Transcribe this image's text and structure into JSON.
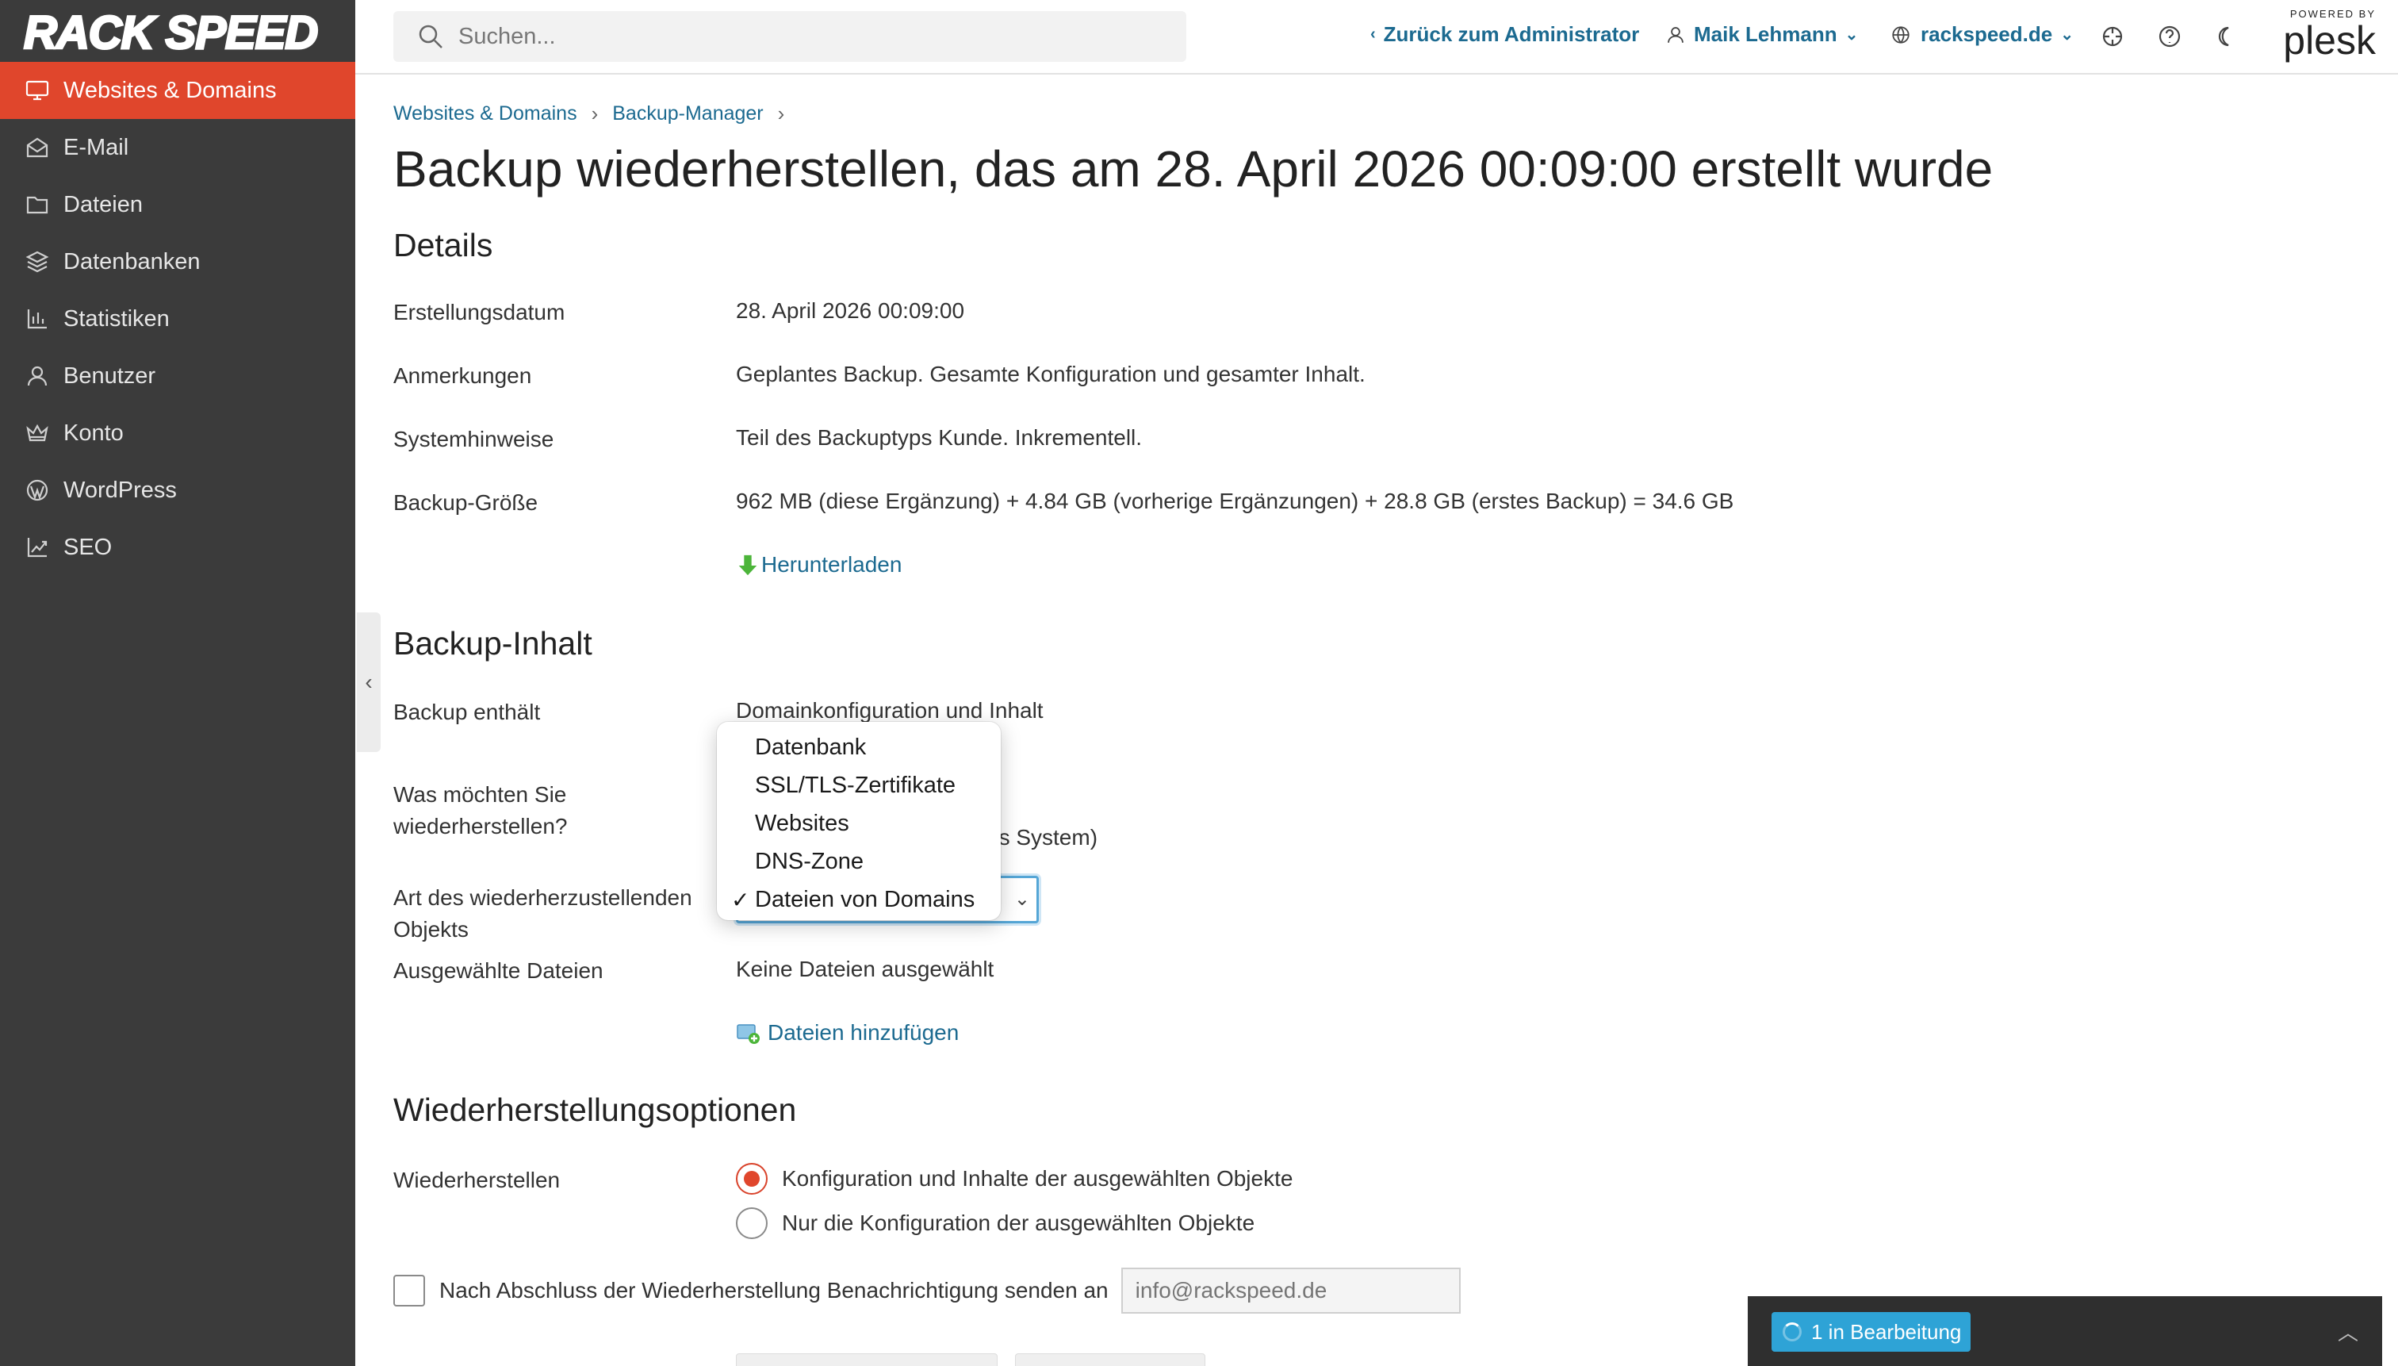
{
  "brand": {
    "logo_text": "RACK SPEED",
    "accent": "#e0462c",
    "link_color": "#1c6a90"
  },
  "sidebar": {
    "items": [
      {
        "label": "Websites & Domains",
        "icon": "monitor-icon",
        "active": true
      },
      {
        "label": "E-Mail",
        "icon": "mail-icon"
      },
      {
        "label": "Dateien",
        "icon": "folder-icon"
      },
      {
        "label": "Datenbanken",
        "icon": "database-icon"
      },
      {
        "label": "Statistiken",
        "icon": "bar-chart-icon"
      },
      {
        "label": "Benutzer",
        "icon": "user-icon"
      },
      {
        "label": "Konto",
        "icon": "crown-icon"
      },
      {
        "label": "WordPress",
        "icon": "wordpress-icon"
      },
      {
        "label": "SEO",
        "icon": "seo-chart-icon"
      }
    ]
  },
  "header": {
    "search_placeholder": "Suchen...",
    "back_link": "Zurück zum Administrator",
    "user": "Maik Lehmann",
    "domain": "rackspeed.de",
    "powered_by": "POWERED BY",
    "plesk": "plesk"
  },
  "breadcrumb": {
    "items": [
      "Websites & Domains",
      "Backup-Manager"
    ]
  },
  "page_title": "Backup wiederherstellen, das am 28. April 2026 00:09:00 erstellt wurde",
  "details": {
    "title": "Details",
    "created_label": "Erstellungsdatum",
    "created_value": "28. April 2026 00:09:00",
    "notes_label": "Anmerkungen",
    "notes_value": "Geplantes Backup. Gesamte Konfiguration und gesamter Inhalt.",
    "system_label": "Systemhinweise",
    "system_value": "Teil des Backuptyps Kunde. Inkrementell.",
    "size_label": "Backup-Größe",
    "size_value": "962 MB (diese Ergänzung) + 4.84 GB (vorherige Ergänzungen) + 28.8 GB (erstes Backup) = 34.6 GB",
    "download_link": "Herunterladen"
  },
  "content": {
    "title": "Backup-Inhalt",
    "contains_label": "Backup enthält",
    "contains_value": "Domainkonfiguration und Inhalt",
    "restore_what_label_1": "Was möchten Sie",
    "restore_what_label_2": "wiederherstellen?",
    "restore_what_behind": "es System)",
    "object_type_label_1": "Art des wiederherzustellenden",
    "object_type_label_2": "Objekts",
    "object_type_options": [
      "Datenbank",
      "SSL/TLS-Zertifikate",
      "Websites",
      "DNS-Zone",
      "Dateien von Domains"
    ],
    "object_type_selected": "Dateien von Domains",
    "selected_files_label": "Ausgewählte Dateien",
    "selected_files_value": "Keine Dateien ausgewählt",
    "add_files_link": "Dateien hinzufügen"
  },
  "options": {
    "title": "Wiederherstellungsoptionen",
    "restore_label": "Wiederherstellen",
    "radio_1": "Konfiguration und Inhalte der ausgewählten Objekte",
    "radio_2": "Nur die Konfiguration der ausgewählten Objekte",
    "radio_selected": 1,
    "notify_label": "Nach Abschluss der Wiederherstellung Benachrichtigung senden an",
    "notify_email_placeholder": "info@rackspeed.de"
  },
  "taskbar": {
    "label": "1 in Bearbeitung"
  }
}
